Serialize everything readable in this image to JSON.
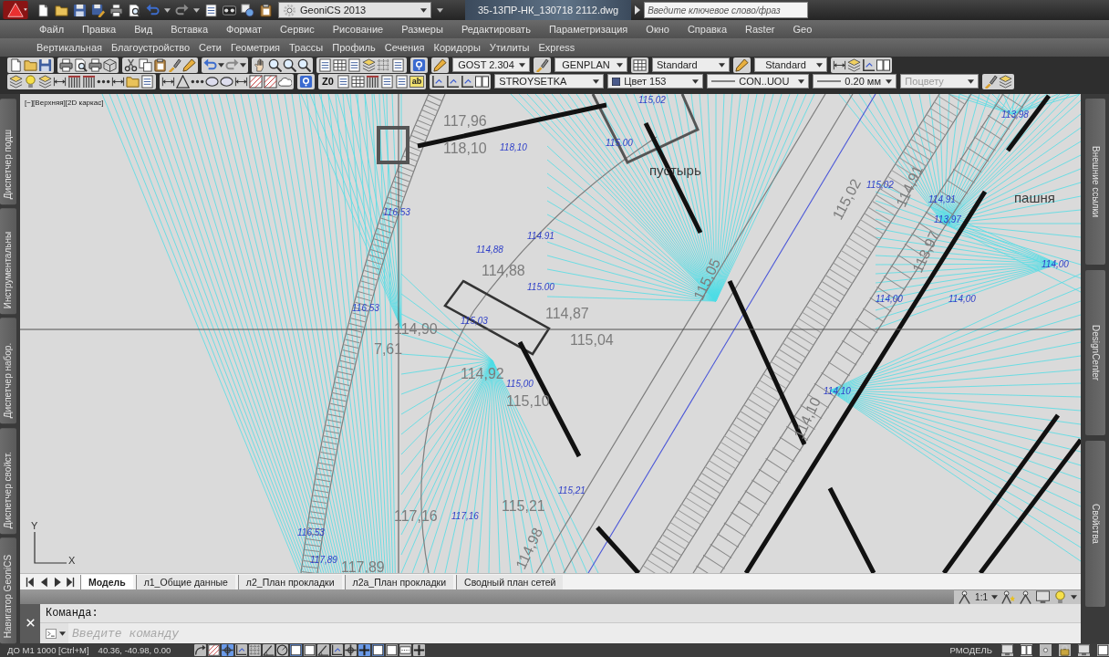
{
  "title_bar": {
    "workspace": "GeoniCS 2013",
    "file_name": "35-13ПР-НК_130718 2112.dwg",
    "search": {
      "placeholder": "Введите ключевое слово/фраз"
    }
  },
  "menus": [
    [
      "Файл",
      "Правка",
      "Вид",
      "Вставка",
      "Формат",
      "Сервис",
      "Рисование",
      "Размеры",
      "Редактировать",
      "Параметризация",
      "Окно",
      "Справка",
      "Raster",
      "Geo"
    ],
    [
      "Вертикальная",
      "Благоустройство",
      "Сети",
      "Геометрия",
      "Трассы",
      "Профиль",
      "Сечения",
      "Коридоры",
      "Утилиты",
      "Express"
    ]
  ],
  "styles_toolbar": {
    "text_style": "GOST 2.304",
    "dim_style": "GENPLAN",
    "table_style": "Standard",
    "mleader_style": "Standard"
  },
  "layers_toolbar": {
    "elevation_button": "Z0",
    "text_button": "ab",
    "layer": "STROYSETKA",
    "color_name": "Цвет 153",
    "linetype": "CON..UOU",
    "lineweight": "0.20 мм",
    "plot_style": {
      "label": "Поцвету",
      "disabled": true
    }
  },
  "left_palettes": [
    "Диспетчер подш",
    "Инструментальны",
    "Диспетчер набор.",
    "Диспетчер свойст.",
    "Навигатор GeoniCS"
  ],
  "viewport": {
    "view_label": "[−][Верхняя][2D каркас]",
    "areas": [
      "пустырь",
      "пашня"
    ],
    "elevations": [
      {
        "text": "113,98",
        "kind": "small"
      },
      {
        "text": "117,96",
        "kind": "large"
      },
      {
        "text": "115,02",
        "kind": "small"
      },
      {
        "text": "118,10",
        "kind": "large"
      },
      {
        "text": "118,10",
        "kind": "small"
      },
      {
        "text": "115.00",
        "kind": "small"
      },
      {
        "text": "115,02",
        "kind": "large"
      },
      {
        "text": "114,91",
        "kind": "large"
      },
      {
        "text": "115,02",
        "kind": "small"
      },
      {
        "text": "114,91",
        "kind": "small"
      },
      {
        "text": "116.53",
        "kind": "small"
      },
      {
        "text": "113,97",
        "kind": "small"
      },
      {
        "text": "114.91",
        "kind": "small"
      },
      {
        "text": "114,88",
        "kind": "small"
      },
      {
        "text": "113,97",
        "kind": "large"
      },
      {
        "text": "114,00",
        "kind": "small"
      },
      {
        "text": "114,88",
        "kind": "large"
      },
      {
        "text": "115.00",
        "kind": "small"
      },
      {
        "text": "115,05",
        "kind": "large"
      },
      {
        "text": "114,00",
        "kind": "small"
      },
      {
        "text": "114,00",
        "kind": "small"
      },
      {
        "text": "116.53",
        "kind": "small"
      },
      {
        "text": "114,87",
        "kind": "large"
      },
      {
        "text": "115,03",
        "kind": "small"
      },
      {
        "text": "114,90",
        "kind": "large"
      },
      {
        "text": "115,04",
        "kind": "large"
      },
      {
        "text": "7,61",
        "kind": "large"
      },
      {
        "text": "114,92",
        "kind": "large"
      },
      {
        "text": "115,00",
        "kind": "small"
      },
      {
        "text": "114,10",
        "kind": "small"
      },
      {
        "text": "115,10",
        "kind": "large"
      },
      {
        "text": "114,10",
        "kind": "large"
      },
      {
        "text": "115,21",
        "kind": "small"
      },
      {
        "text": "115,21",
        "kind": "large"
      },
      {
        "text": "117,16",
        "kind": "large"
      },
      {
        "text": "117,16",
        "kind": "small"
      },
      {
        "text": "116,53",
        "kind": "small"
      },
      {
        "text": "114,98",
        "kind": "large"
      },
      {
        "text": "117,89",
        "kind": "small"
      },
      {
        "text": "117,89",
        "kind": "large"
      }
    ],
    "ucs": {
      "y": "Y",
      "x": "X"
    }
  },
  "layout_tabs": [
    {
      "label": "Модель",
      "selected": true
    },
    {
      "label": "л1_Общие данные",
      "selected": false
    },
    {
      "label": "л2_План прокладки",
      "selected": false
    },
    {
      "label": "л2а_План прокладки",
      "selected": false
    },
    {
      "label": "Сводный план сетей",
      "selected": false
    }
  ],
  "right_palettes": [
    "Внешние ссылки",
    "DesignCenter",
    "Свойства"
  ],
  "annotation_scale": "1:1",
  "command_line": {
    "history": "Команда:",
    "placeholder": "Введите команду"
  },
  "status_bar": {
    "mode": "ДО М1 1000 [Ctrl+M]",
    "coordinates": "40.36, -40.98, 0.00",
    "toggles": [
      {
        "on": false
      },
      {
        "on": false
      },
      {
        "on": true
      },
      {
        "on": false
      },
      {
        "on": false
      },
      {
        "on": false
      },
      {
        "on": false
      },
      {
        "on": true
      },
      {
        "on": false
      },
      {
        "on": false
      },
      {
        "on": false
      },
      {
        "on": false
      },
      {
        "on": true
      },
      {
        "on": true
      },
      {
        "on": false
      },
      {
        "on": false
      },
      {
        "on": false
      }
    ],
    "space": "РМОДЕЛЬ"
  }
}
